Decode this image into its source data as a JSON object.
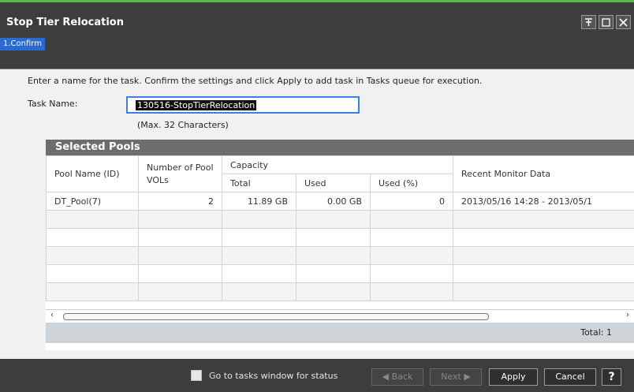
{
  "window": {
    "title": "Stop Tier Relocation"
  },
  "steps": [
    {
      "label": "1.Confirm",
      "active": true
    }
  ],
  "instruction": "Enter a name for the task. Confirm the settings and click Apply to add task in Tasks queue for execution.",
  "task": {
    "label": "Task Name:",
    "value": "130516-StopTierRelocation",
    "hint": "(Max. 32 Characters)"
  },
  "pools": {
    "title": "Selected Pools",
    "headers": {
      "pool_name": "Pool Name (ID)",
      "num_vols": "Number of Pool VOLs",
      "capacity": "Capacity",
      "total": "Total",
      "used": "Used",
      "used_pct": "Used (%)",
      "recent": "Recent Monitor Data"
    },
    "rows": [
      {
        "pool_name": "DT_Pool(7)",
        "num_vols": "2",
        "total": "11.89 GB",
        "used": "0.00 GB",
        "used_pct": "0",
        "recent": "2013/05/16 14:28 - 2013/05/1"
      }
    ],
    "total_label": "Total:",
    "total_value": "1"
  },
  "footer": {
    "checkbox_label": "Go to tasks window for status",
    "checkbox_checked": false,
    "back_label": "Back",
    "next_label": "Next",
    "apply_label": "Apply",
    "cancel_label": "Cancel",
    "help_label": "?"
  },
  "colors": {
    "accent": "#2a6bd1",
    "titlebar": "#3d3d3d",
    "topline": "#5cb847"
  }
}
